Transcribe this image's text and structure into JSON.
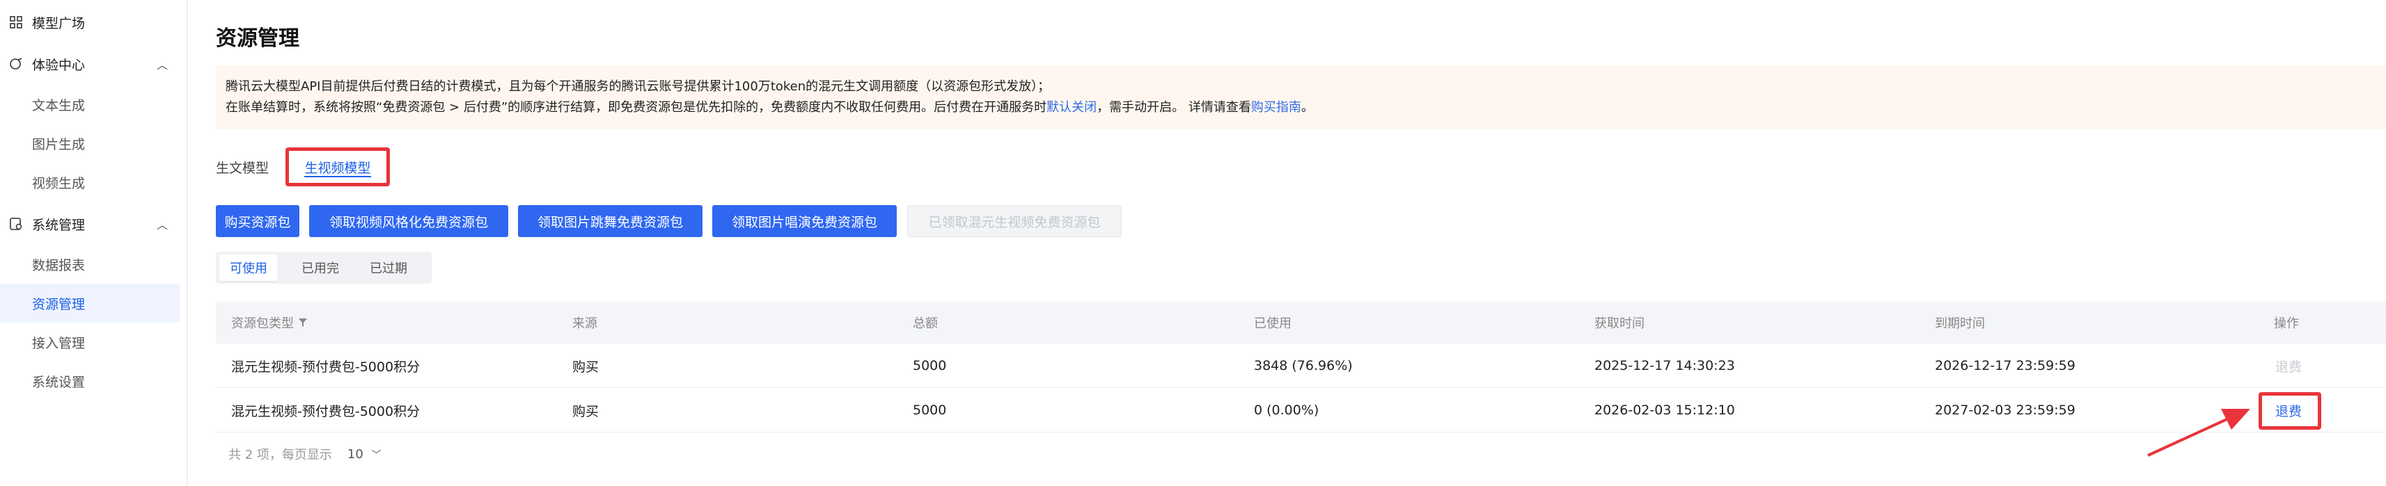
{
  "sidebar": {
    "model_square": "模型广场",
    "experience_center": "体验中心",
    "exp_items": [
      "文本生成",
      "图片生成",
      "视频生成"
    ],
    "system_mgmt": "系统管理",
    "sys_items": [
      "数据报表",
      "资源管理",
      "接入管理",
      "系统设置"
    ]
  },
  "page": {
    "title": "资源管理"
  },
  "notice": {
    "line1": "腾讯云大模型API目前提供后付费日结的计费模式，且为每个开通服务的腾讯云账号提供累计100万token的混元生文调用额度（以资源包形式发放）；",
    "line2_a": "在账单结算时，系统将按照“免费资源包 > 后付费”的顺序进行结算，即免费资源包是优先扣除的，免费额度内不收取任何费用。后付费在开通服务时",
    "line2_link1": "默认关闭",
    "line2_b": "，需手动开启。 详情请查看",
    "line2_link2": "购买指南",
    "line2_c": "。"
  },
  "tabs": {
    "text_model": "生文模型",
    "video_model": "生视频模型"
  },
  "buttons": {
    "buy": "购买资源包",
    "b2": "领取视频风格化免费资源包",
    "b3": "领取图片跳舞免费资源包",
    "b4": "领取图片唱演免费资源包",
    "b5": "已领取混元生视频免费资源包"
  },
  "segments": {
    "available": "可使用",
    "used_up": "已用完",
    "expired": "已过期"
  },
  "table": {
    "headers": {
      "type": "资源包类型",
      "source": "来源",
      "total": "总额",
      "used": "已使用",
      "acquired": "获取时间",
      "expire": "到期时间",
      "action": "操作"
    },
    "rows": [
      {
        "type": "混元生视频-预付费包-5000积分",
        "source": "购买",
        "total": "5000",
        "used": "3848 (76.96%)",
        "acquired": "2025-12-17 14:30:23",
        "expire": "2026-12-17 23:59:59",
        "action": "退费"
      },
      {
        "type": "混元生视频-预付费包-5000积分",
        "source": "购买",
        "total": "5000",
        "used": "0 (0.00%)",
        "acquired": "2026-02-03 15:12:10",
        "expire": "2027-02-03 23:59:59",
        "action": "退费"
      }
    ]
  },
  "pager": {
    "summary": "共 2 项，每页显示",
    "page_size": "10"
  },
  "colors": {
    "primary": "#2f67f1",
    "highlight": "#e8343b",
    "notice_bg": "#fff7ef"
  }
}
